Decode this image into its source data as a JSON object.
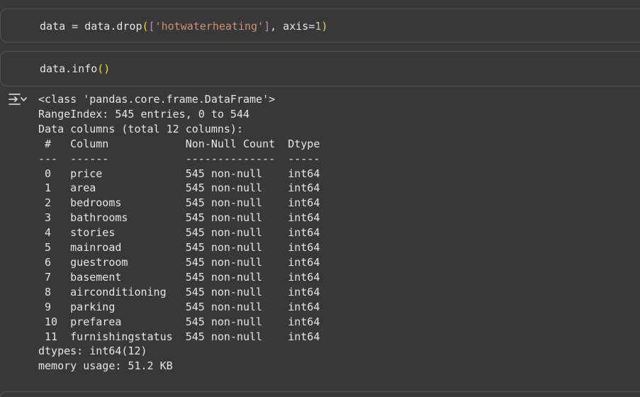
{
  "cells": [
    {
      "code": {
        "var": "data",
        "eq": " = ",
        "call": "data.drop",
        "open_paren": "(",
        "open_bracket": "[",
        "string": "'hotwaterheating'",
        "close_bracket": "]",
        "args": ", axis=",
        "num": "1",
        "close_paren": ")"
      }
    },
    {
      "code": {
        "call": "data.info",
        "parens": "()"
      }
    }
  ],
  "output": {
    "icon": "output-toggle-icon",
    "lines": [
      "<class 'pandas.core.frame.DataFrame'>",
      "RangeIndex: 545 entries, 0 to 544",
      "Data columns (total 12 columns):",
      " #   Column            Non-Null Count  Dtype",
      "---  ------            --------------  -----",
      " 0   price             545 non-null    int64",
      " 1   area              545 non-null    int64",
      " 2   bedrooms          545 non-null    int64",
      " 3   bathrooms         545 non-null    int64",
      " 4   stories           545 non-null    int64",
      " 5   mainroad          545 non-null    int64",
      " 6   guestroom         545 non-null    int64",
      " 7   basement          545 non-null    int64",
      " 8   airconditioning   545 non-null    int64",
      " 9   parking           545 non-null    int64",
      " 10  prefarea          545 non-null    int64",
      " 11  furnishingstatus  545 non-null    int64",
      "dtypes: int64(12)",
      "memory usage: 51.2 KB"
    ]
  },
  "colors": {
    "background": "#383838",
    "text": "#e6e6e6",
    "bracket": "#f5d53a",
    "string": "#ce9178",
    "number": "#b5cea8"
  }
}
